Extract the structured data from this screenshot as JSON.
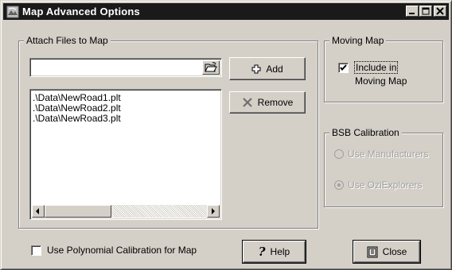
{
  "window": {
    "title": "Map Advanced Options",
    "buttons": {
      "minimize": "_",
      "maximize": "□",
      "close": "×"
    }
  },
  "attach": {
    "group_label": "Attach Files to Map",
    "file_input_value": "",
    "add_label": "Add",
    "remove_label": "Remove",
    "files": [
      ".\\Data\\NewRoad1.plt",
      ".\\Data\\NewRoad2.plt",
      ".\\Data\\NewRoad3.plt"
    ]
  },
  "moving_map": {
    "group_label": "Moving Map",
    "include_line1": "Include in",
    "include_line2": "Moving Map",
    "include_checked": true
  },
  "bsb": {
    "group_label": "BSB Calibration",
    "use_manufacturers": "Use Manufacturers",
    "use_ozi": "Use OziExplorers",
    "selected": "use_ozi",
    "enabled": false
  },
  "bottom": {
    "polynomial_label": "Use Polynomial Calibration for Map",
    "polynomial_checked": false,
    "help_label": "Help",
    "help_glyph": "?",
    "close_label": "Close"
  },
  "icons": [
    "app-icon",
    "folder-open-icon",
    "add-icon",
    "remove-x-icon",
    "help-question-icon",
    "close-door-icon"
  ]
}
